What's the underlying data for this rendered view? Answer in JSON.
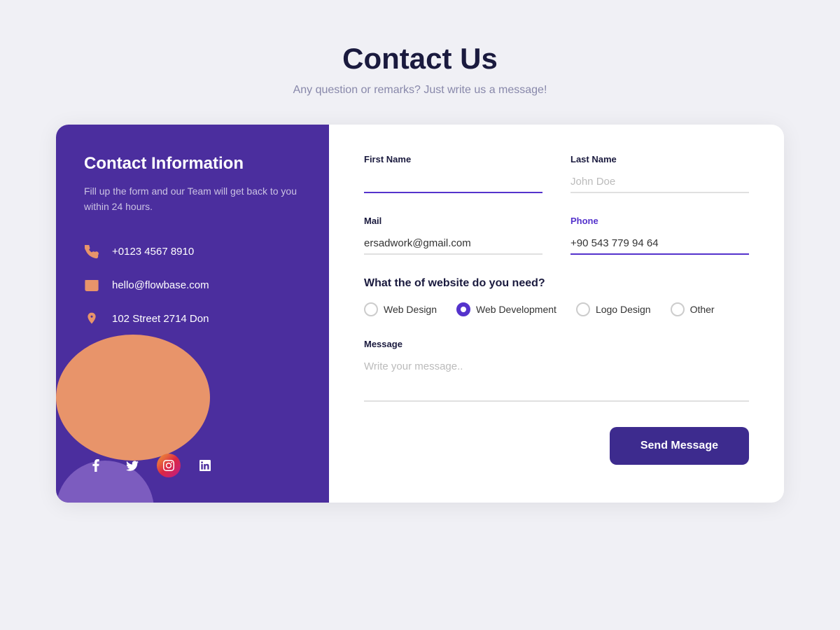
{
  "page": {
    "title": "Contact Us",
    "subtitle": "Any question or remarks? Just write us a message!"
  },
  "info_panel": {
    "title": "Contact Information",
    "description": "Fill up the form and our Team will get back to you within 24 hours.",
    "phone": "+0123 4567 8910",
    "email": "hello@flowbase.com",
    "address": "102 Street 2714 Don"
  },
  "social": {
    "facebook": "f",
    "twitter": "t",
    "instagram": "ig",
    "linkedin": "in"
  },
  "form": {
    "first_name_label": "First Name",
    "first_name_placeholder": "",
    "last_name_label": "Last Name",
    "last_name_placeholder": "John Doe",
    "mail_label": "Mail",
    "mail_value": "ersadwork@gmail.com",
    "phone_label": "Phone",
    "phone_value": "+90 543 779 94 64",
    "question": "What the of website do you need?",
    "options": [
      "Web Design",
      "Web Development",
      "Logo Design",
      "Other"
    ],
    "checked_option": "Web Development",
    "message_label": "Message",
    "message_placeholder": "Write your message..",
    "send_button": "Send Message"
  }
}
